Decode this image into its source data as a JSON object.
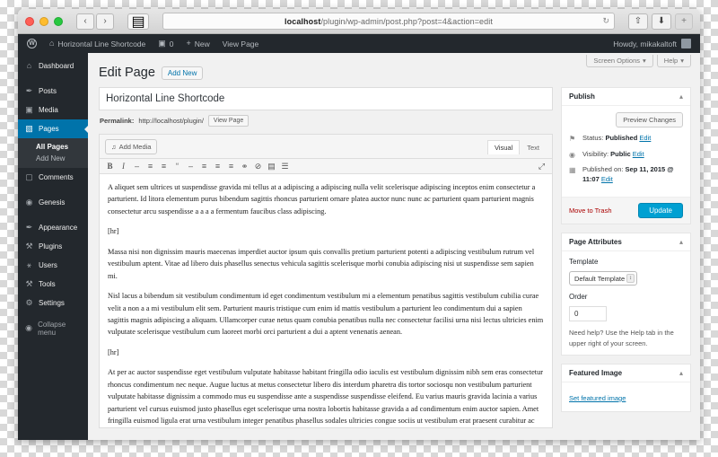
{
  "browser": {
    "url_host": "localhost",
    "url_path": "/plugin/wp-admin/post.php?post=4&action=edit",
    "back_icon": "‹",
    "forward_icon": "›",
    "sidebar_icon": "▤",
    "reload_icon": "↻",
    "share_icon": "⇧",
    "downloads_icon": "⬇",
    "tabs_icon": "+"
  },
  "adminbar": {
    "wp_logo": "W",
    "home_icon": "⌂",
    "site_name": "Horizontal Line Shortcode",
    "comment_icon": "▣",
    "comment_count": "0",
    "new_icon": "+",
    "new_label": "New",
    "view_page": "View Page",
    "howdy": "Howdy, mikakaltoft"
  },
  "sidebar": {
    "items": [
      {
        "label": "Dashboard",
        "icon": "⌂"
      },
      {
        "label": "Posts",
        "icon": "✒"
      },
      {
        "label": "Media",
        "icon": "▣"
      },
      {
        "label": "Pages",
        "icon": "▧"
      },
      {
        "label": "Comments",
        "icon": "▢"
      },
      {
        "label": "Genesis",
        "icon": "◉"
      },
      {
        "label": "Appearance",
        "icon": "✒"
      },
      {
        "label": "Plugins",
        "icon": "⚒"
      },
      {
        "label": "Users",
        "icon": "⚹"
      },
      {
        "label": "Tools",
        "icon": "⚒"
      },
      {
        "label": "Settings",
        "icon": "⚙"
      }
    ],
    "submenu": [
      {
        "label": "All Pages"
      },
      {
        "label": "Add New"
      }
    ],
    "collapse": {
      "label": "Collapse menu",
      "icon": "◉"
    }
  },
  "screen_options": {
    "screen_label": "Screen Options",
    "help_label": "Help",
    "caret": "▾"
  },
  "page": {
    "heading": "Edit Page",
    "add_new": "Add New",
    "title_value": "Horizontal Line Shortcode",
    "permalink_label": "Permalink:",
    "permalink_url": "http://localhost/plugin/",
    "view_page_button": "View Page"
  },
  "editor": {
    "add_media": "Add Media",
    "add_media_icon": "♫",
    "tabs": [
      {
        "label": "Visual",
        "active": true
      },
      {
        "label": "Text",
        "active": false
      }
    ],
    "toolbar_icons": [
      {
        "name": "bold",
        "glyph": "B"
      },
      {
        "name": "italic",
        "glyph": "I"
      },
      {
        "name": "strikethrough",
        "glyph": "–"
      },
      {
        "name": "bulleted-list",
        "glyph": "≡"
      },
      {
        "name": "numbered-list",
        "glyph": "≡"
      },
      {
        "name": "blockquote",
        "glyph": "“"
      },
      {
        "name": "horizontal-rule",
        "glyph": "–"
      },
      {
        "name": "align-left",
        "glyph": "≡"
      },
      {
        "name": "align-center",
        "glyph": "≡"
      },
      {
        "name": "align-right",
        "glyph": "≡"
      },
      {
        "name": "insert-link",
        "glyph": "⚭"
      },
      {
        "name": "remove-link",
        "glyph": "⊘"
      },
      {
        "name": "read-more",
        "glyph": "▤"
      },
      {
        "name": "toolbar-toggle",
        "glyph": "☰"
      }
    ],
    "fullscreen_icon": "⤢",
    "paragraphs": [
      "A aliquet sem ultrices ut suspendisse gravida mi tellus at a adipiscing a adipiscing nulla velit scelerisque adipiscing inceptos enim consectetur a parturient. Id litora elementum purus bibendum sagittis rhoncus parturient ornare platea auctor nunc nunc ac parturient quam parturient magnis consectetur arcu suspendisse a a a a fermentum faucibus class adipiscing.",
      "[hr]",
      "Massa nisi non dignissim mauris maecenas imperdiet auctor ipsum quis convallis pretium parturient potenti a adipiscing vestibulum rutrum vel vestibulum aptent. Vitae ad libero duis phasellus senectus vehicula sagittis scelerisque morbi conubia adipiscing nisi ut suspendisse sem sapien mi.",
      "Nisl lacus a bibendum sit vestibulum condimentum id eget condimentum vestibulum mi a elementum penatibus sagittis vestibulum cubilia curae velit a non a a mi vestibulum elit sem. Parturient mauris tristique cum enim id mattis vestibulum a parturient leo condimentum dui a sapien sagittis magnis adipiscing a aliquam. Ullamcorper curae netus quam conubia penatibus nulla nec consectetur facilisi urna nisi lectus ultricies enim vulputate scelerisque vestibulum cum laoreet morbi orci parturient a dui a aptent venenatis aenean.",
      "[hr]",
      "At per ac auctor suspendisse eget vestibulum vulputate habitasse habitant fringilla odio iaculis est vestibulum dignissim nibh sem eras consectetur rhoncus condimentum nec neque. Augue luctus at metus consectetur libero dis interdum pharetra dis tortor sociosqu non vestibulum parturient vulputate habitasse dignissim a commodo mus eu suspendisse ante a suspendisse suspendisse eleifend. Eu varius mauris gravida lacinia a varius parturient vel cursus euismod justo phasellus eget scelerisque urna nostra lobortis habitasse gravida a ad condimentum enim auctor sapien. Amet fringilla euismod ligula erat urna vestibulum integer penatibus phasellus sodales ultricies congue sociis ut vestibulum erat praesent curabitur ac vestibulum vivamus nibh"
    ]
  },
  "publish": {
    "title": "Publish",
    "toggle": "▴",
    "preview_changes": "Preview Changes",
    "status_icon": "⚑",
    "status_label": "Status:",
    "status_value": "Published",
    "status_edit": "Edit",
    "visibility_icon": "◉",
    "visibility_label": "Visibility:",
    "visibility_value": "Public",
    "visibility_edit": "Edit",
    "date_icon": "▦",
    "date_label": "Published on:",
    "date_value": "Sep 11, 2015 @ 11:07",
    "date_edit": "Edit",
    "move_to_trash": "Move to Trash",
    "update": "Update",
    "update_color": "#00a0d2"
  },
  "page_attributes": {
    "title": "Page Attributes",
    "toggle": "▴",
    "template_label": "Template",
    "template_value": "Default Template",
    "select_arrows": "↕",
    "order_label": "Order",
    "order_value": "0",
    "help_text": "Need help? Use the Help tab in the upper right of your screen."
  },
  "featured_image": {
    "title": "Featured Image",
    "toggle": "▴",
    "set_link": "Set featured image"
  }
}
